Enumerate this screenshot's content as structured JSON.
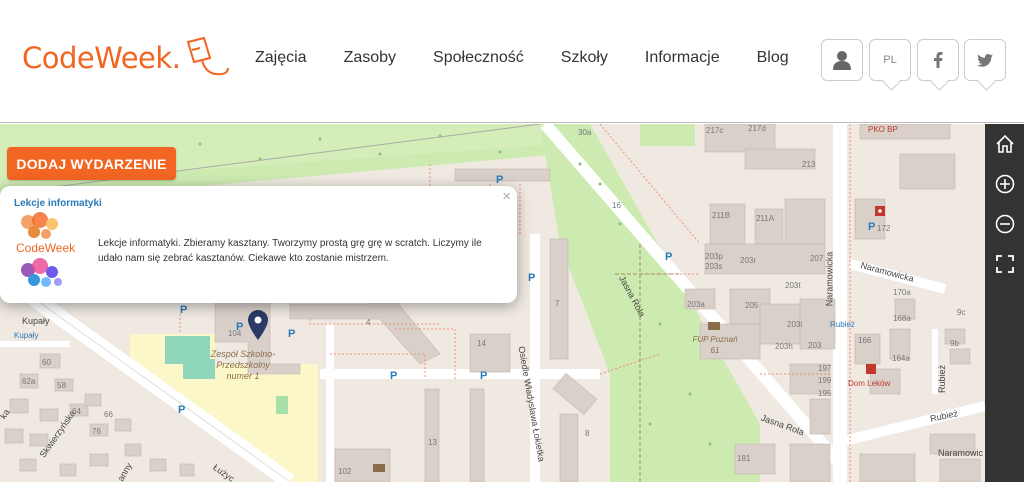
{
  "header": {
    "logo_text": "CodeWeek.",
    "nav": [
      "Zajęcia",
      "Zasoby",
      "Społeczność",
      "Szkoły",
      "Informacje",
      "Blog"
    ],
    "lang_label": "PL",
    "icons": [
      "user-icon",
      "language-icon",
      "facebook-icon",
      "twitter-icon"
    ]
  },
  "map": {
    "add_event_label": "DODAJ WYDARZENIE",
    "popup": {
      "title": "Lekcje informatyki",
      "logo_text": "CodeWeek",
      "description": "Lekcje informatyki. Zbieramy kasztany. Tworzymy prostą grę grę w scratch. Liczymy ile udało nam się zebrać kasztanów. Ciekawe kto zostanie mistrzem.",
      "close": "×"
    },
    "labels": {
      "street_jasna_rola_1": "Jasna Rola",
      "street_jasna_rola_2": "Jasna Rola",
      "street_naramowicka_v": "Naramowicka",
      "street_naramowicka_h": "Naramowicka",
      "street_naramowic_short": "Naramowic",
      "street_osiedle": "Osiedle Władysława Łokietka",
      "street_rubiez_v": "Rubież",
      "street_rubiez_h": "Rubież",
      "street_skwierzynska": "Skwierzyńska",
      "street_kupaly": "Kupały",
      "street_kupaly_stop": "Kupały",
      "street_lu": "Łużyc",
      "street_anny": "anny",
      "street_ka": "ka",
      "school": "Zespół Szkolno-Przedszkolny numer 1",
      "fup": "FUP Poznań 61",
      "dom_lekow": "Dom Leków",
      "pko": "PKO BP",
      "rubiez_stop": "Rubież",
      "bld_104": "104",
      "bld_30a": "30a",
      "bld_217c": "217c",
      "bld_217d": "217d",
      "bld_213": "213",
      "bld_211b": "211B",
      "bld_211a": "211A",
      "bld_203p": "203p",
      "bld_203s": "203s",
      "bld_203r": "203r",
      "bld_203t": "203t",
      "bld_207": "207",
      "bld_203a": "203a",
      "bld_205": "205",
      "bld_203i": "203i",
      "bld_203h": "203h",
      "bld_203": "203",
      "bld_197": "197",
      "bld_199": "199",
      "bld_195": "195",
      "bld_181": "181",
      "bld_172": "172",
      "bld_170a": "170a",
      "bld_168a": "168a",
      "bld_166": "166",
      "bld_164a": "164a",
      "bld_9c": "9c",
      "bld_9b": "9b",
      "bld_16": "16",
      "bld_7": "7",
      "bld_4": "4",
      "bld_14": "14",
      "bld_13": "13",
      "bld_8": "8",
      "bld_102": "102",
      "bld_60": "60",
      "bld_62a": "62a",
      "bld_66": "66",
      "bld_76": "76",
      "bld_64": "64",
      "bld_58": "58"
    },
    "parking": "P"
  },
  "sidebar": {
    "icons": [
      "home-icon",
      "zoom-in-icon",
      "zoom-out-icon",
      "fullscreen-icon"
    ]
  },
  "colors": {
    "accent": "#f26522",
    "link": "#2a7ab8",
    "sidebar": "#333333"
  }
}
